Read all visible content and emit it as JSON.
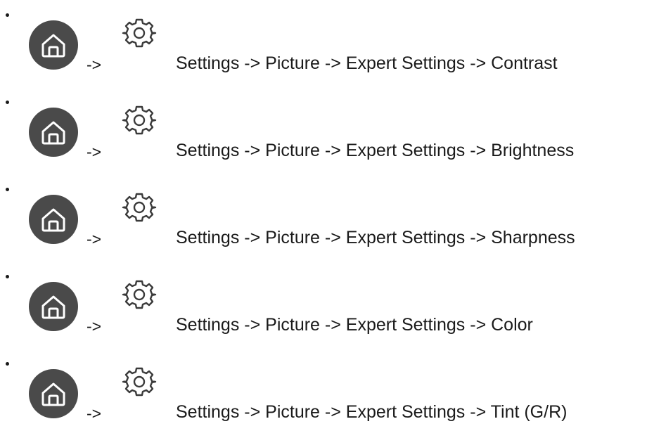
{
  "items": [
    {
      "arrow": "->",
      "path": "Settings -> Picture -> Expert Settings -> Contrast",
      "icons": [
        "home-icon",
        "gear-icon"
      ]
    },
    {
      "arrow": "->",
      "path": "Settings -> Picture -> Expert Settings -> Brightness",
      "icons": [
        "home-icon",
        "gear-icon"
      ]
    },
    {
      "arrow": "->",
      "path": "Settings -> Picture -> Expert Settings -> Sharpness",
      "icons": [
        "home-icon",
        "gear-icon"
      ]
    },
    {
      "arrow": "->",
      "path": "Settings -> Picture -> Expert Settings -> Color",
      "icons": [
        "home-icon",
        "gear-icon"
      ]
    },
    {
      "arrow": "->",
      "path": "Settings -> Picture -> Expert Settings -> Tint (G/R)",
      "icons": [
        "home-icon",
        "gear-icon"
      ]
    }
  ],
  "colors": {
    "text": "#1a1a1a",
    "home_circle": "#4a4a4a",
    "home_glyph": "#ffffff",
    "gear_stroke": "#3a3a3a"
  }
}
